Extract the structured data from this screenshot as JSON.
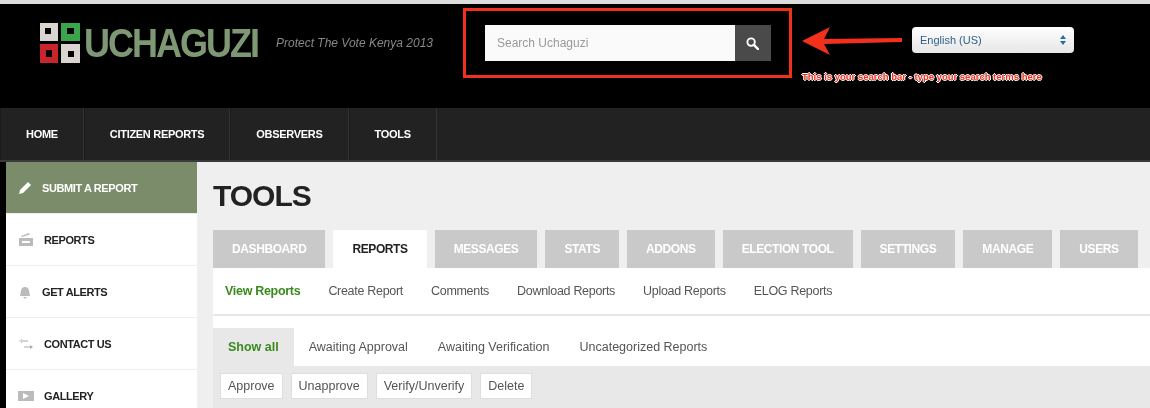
{
  "logo": {
    "wordmark": "UCHAGUZI",
    "tagline": "Protect The Vote Kenya 2013"
  },
  "search": {
    "placeholder": "Search Uchaguzi"
  },
  "language": {
    "value": "English (US)"
  },
  "annotation": {
    "text": "This is your search bar - type your search terms here"
  },
  "nav": [
    {
      "label": "HOME"
    },
    {
      "label": "CITIZEN REPORTS"
    },
    {
      "label": "OBSERVERS"
    },
    {
      "label": "TOOLS"
    }
  ],
  "sidebar": [
    {
      "label": "SUBMIT A REPORT",
      "kind": "pencil",
      "selected": true
    },
    {
      "label": "REPORTS",
      "kind": "tray",
      "selected": false
    },
    {
      "label": "GET ALERTS",
      "kind": "bell",
      "selected": false
    },
    {
      "label": "CONTACT US",
      "kind": "arrows",
      "selected": false
    },
    {
      "label": "GALLERY",
      "kind": "film",
      "selected": false
    }
  ],
  "page_title": "TOOLS",
  "tabs": [
    {
      "label": "DASHBOARD",
      "selected": false
    },
    {
      "label": "REPORTS",
      "selected": true
    },
    {
      "label": "MESSAGES",
      "selected": false
    },
    {
      "label": "STATS",
      "selected": false
    },
    {
      "label": "ADDONS",
      "selected": false
    },
    {
      "label": "ELECTION TOOL",
      "selected": false
    },
    {
      "label": "SETTINGS",
      "selected": false
    },
    {
      "label": "MANAGE",
      "selected": false
    },
    {
      "label": "USERS",
      "selected": false
    }
  ],
  "subnav": [
    {
      "label": "View Reports",
      "selected": true
    },
    {
      "label": "Create Report",
      "selected": false
    },
    {
      "label": "Comments",
      "selected": false
    },
    {
      "label": "Download Reports",
      "selected": false
    },
    {
      "label": "Upload Reports",
      "selected": false
    },
    {
      "label": "ELOG Reports",
      "selected": false
    }
  ],
  "filters": [
    {
      "label": "Show all",
      "selected": true
    },
    {
      "label": "Awaiting Approval",
      "selected": false
    },
    {
      "label": "Awaiting Verification",
      "selected": false
    },
    {
      "label": "Uncategorized Reports",
      "selected": false
    }
  ],
  "actions": [
    "Approve",
    "Unapprove",
    "Verify/Unverify",
    "Delete"
  ]
}
